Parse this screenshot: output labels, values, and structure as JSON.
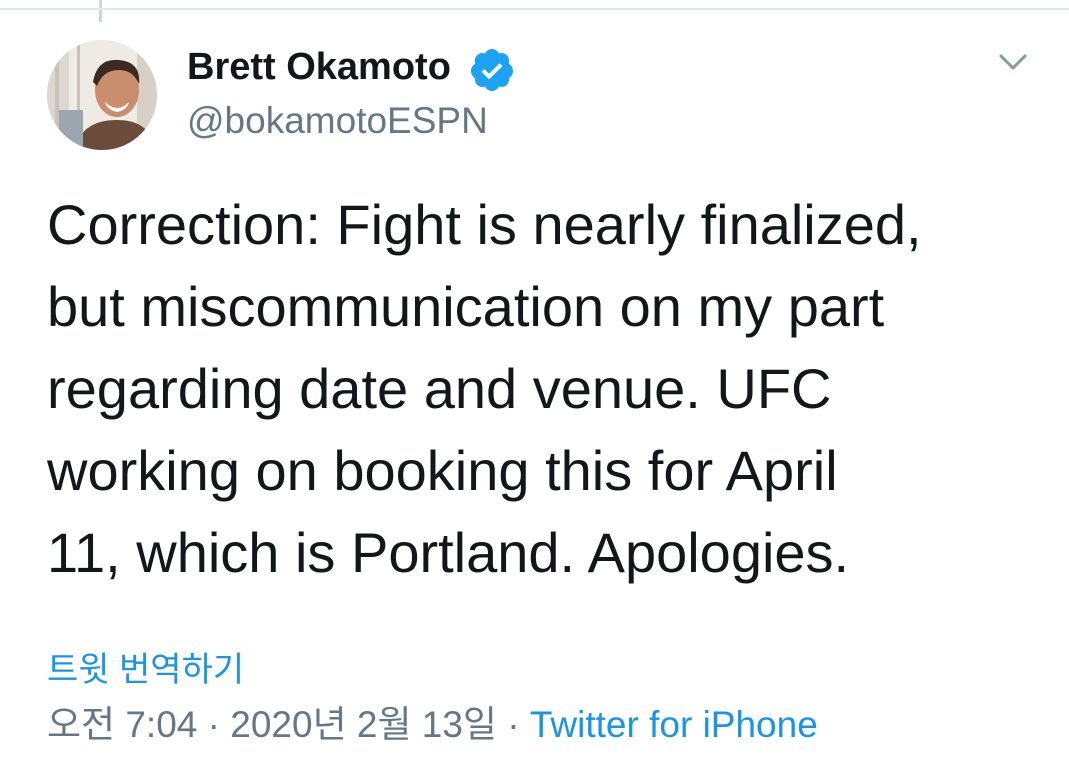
{
  "tweet": {
    "author_name": "Brett Okamoto",
    "handle": "@bokamotoESPN",
    "verified": true,
    "text_lines": [
      "Correction: Fight is nearly finalized,",
      "but miscommunication on my part",
      "regarding date and venue. UFC",
      "working on booking this for April",
      "11, which is Portland. Apologies."
    ],
    "translate_label": "트윗 번역하기",
    "timestamp": "오전 7:04 · 2020년 2월 13일",
    "separator": " · ",
    "source": "Twitter for iPhone"
  },
  "icons": {
    "verified": "verified-badge-icon",
    "menu": "chevron-down-icon"
  },
  "colors": {
    "text": "#14171a",
    "secondary": "#657786",
    "link": "#1b95e0",
    "verified": "#1da1f2"
  }
}
